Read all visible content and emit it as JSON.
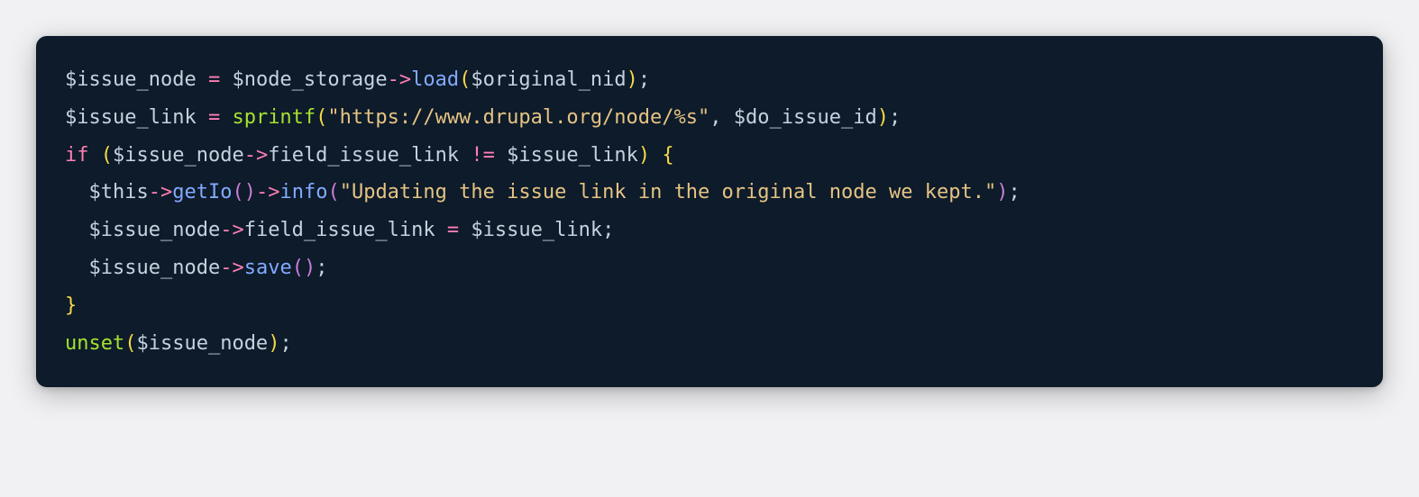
{
  "code": {
    "lines": [
      {
        "indent": 0,
        "tokens": [
          {
            "t": "$issue_node",
            "c": "var"
          },
          {
            "t": " ",
            "c": "var"
          },
          {
            "t": "=",
            "c": "op"
          },
          {
            "t": " ",
            "c": "var"
          },
          {
            "t": "$node_storage",
            "c": "var"
          },
          {
            "t": "->",
            "c": "op"
          },
          {
            "t": "load",
            "c": "method"
          },
          {
            "t": "(",
            "c": "paren"
          },
          {
            "t": "$original_nid",
            "c": "var"
          },
          {
            "t": ")",
            "c": "paren"
          },
          {
            "t": ";",
            "c": "punct"
          }
        ]
      },
      {
        "indent": 0,
        "tokens": [
          {
            "t": "$issue_link",
            "c": "var"
          },
          {
            "t": " ",
            "c": "var"
          },
          {
            "t": "=",
            "c": "op"
          },
          {
            "t": " ",
            "c": "var"
          },
          {
            "t": "sprintf",
            "c": "func"
          },
          {
            "t": "(",
            "c": "paren"
          },
          {
            "t": "\"https://www.drupal.org/node/%s\"",
            "c": "string"
          },
          {
            "t": ",",
            "c": "punct"
          },
          {
            "t": " ",
            "c": "var"
          },
          {
            "t": "$do_issue_id",
            "c": "var"
          },
          {
            "t": ")",
            "c": "paren"
          },
          {
            "t": ";",
            "c": "punct"
          }
        ]
      },
      {
        "indent": 0,
        "tokens": [
          {
            "t": "if",
            "c": "keyword"
          },
          {
            "t": " ",
            "c": "var"
          },
          {
            "t": "(",
            "c": "paren"
          },
          {
            "t": "$issue_node",
            "c": "var"
          },
          {
            "t": "->",
            "c": "op"
          },
          {
            "t": "field_issue_link",
            "c": "var"
          },
          {
            "t": " ",
            "c": "var"
          },
          {
            "t": "!=",
            "c": "op"
          },
          {
            "t": " ",
            "c": "var"
          },
          {
            "t": "$issue_link",
            "c": "var"
          },
          {
            "t": ")",
            "c": "paren"
          },
          {
            "t": " ",
            "c": "var"
          },
          {
            "t": "{",
            "c": "paren"
          }
        ]
      },
      {
        "indent": 1,
        "tokens": [
          {
            "t": "$this",
            "c": "var"
          },
          {
            "t": "->",
            "c": "op"
          },
          {
            "t": "getIo",
            "c": "method"
          },
          {
            "t": "(",
            "c": "paren2"
          },
          {
            "t": ")",
            "c": "paren2"
          },
          {
            "t": "->",
            "c": "op"
          },
          {
            "t": "info",
            "c": "method"
          },
          {
            "t": "(",
            "c": "paren2"
          },
          {
            "t": "\"Updating the issue link in the original node we kept.\"",
            "c": "string"
          },
          {
            "t": ")",
            "c": "paren2"
          },
          {
            "t": ";",
            "c": "punct"
          }
        ]
      },
      {
        "indent": 1,
        "tokens": [
          {
            "t": "$issue_node",
            "c": "var"
          },
          {
            "t": "->",
            "c": "op"
          },
          {
            "t": "field_issue_link",
            "c": "var"
          },
          {
            "t": " ",
            "c": "var"
          },
          {
            "t": "=",
            "c": "op"
          },
          {
            "t": " ",
            "c": "var"
          },
          {
            "t": "$issue_link",
            "c": "var"
          },
          {
            "t": ";",
            "c": "punct"
          }
        ]
      },
      {
        "indent": 1,
        "tokens": [
          {
            "t": "$issue_node",
            "c": "var"
          },
          {
            "t": "->",
            "c": "op"
          },
          {
            "t": "save",
            "c": "method"
          },
          {
            "t": "(",
            "c": "paren2"
          },
          {
            "t": ")",
            "c": "paren2"
          },
          {
            "t": ";",
            "c": "punct"
          }
        ]
      },
      {
        "indent": 0,
        "tokens": [
          {
            "t": "}",
            "c": "paren"
          }
        ]
      },
      {
        "indent": 0,
        "tokens": [
          {
            "t": "unset",
            "c": "func"
          },
          {
            "t": "(",
            "c": "paren"
          },
          {
            "t": "$issue_node",
            "c": "var"
          },
          {
            "t": ")",
            "c": "paren"
          },
          {
            "t": ";",
            "c": "punct"
          }
        ]
      }
    ]
  }
}
